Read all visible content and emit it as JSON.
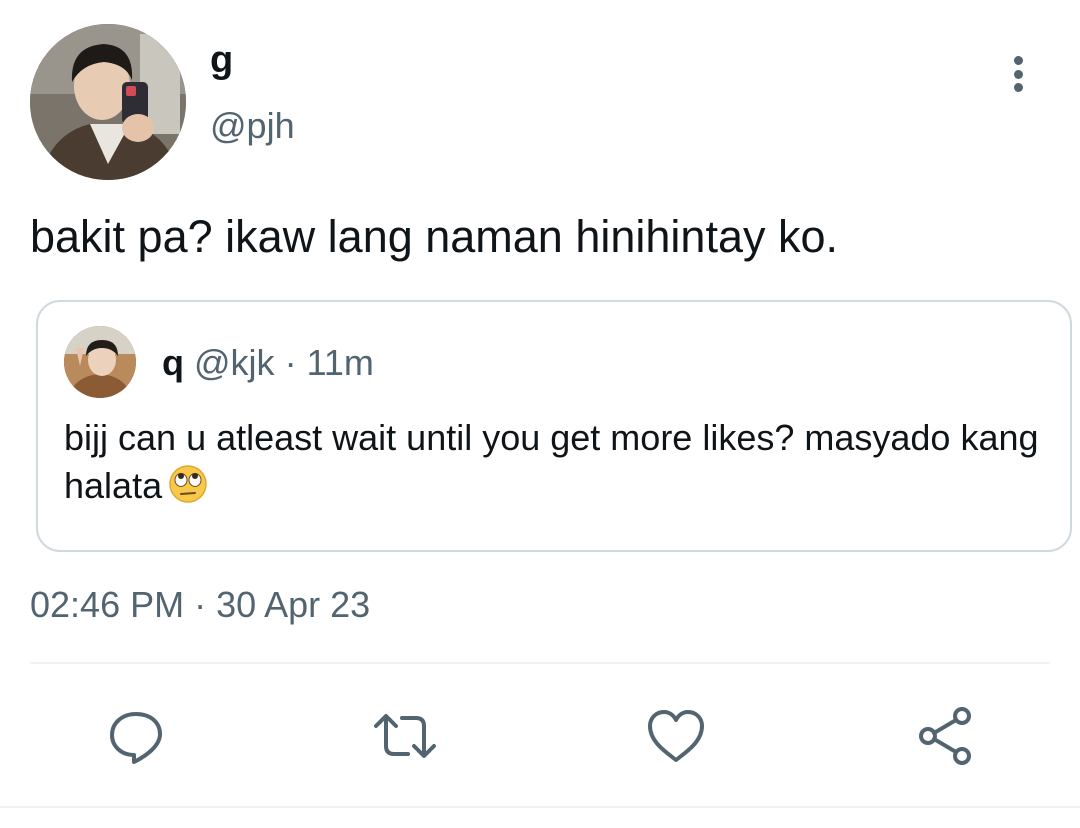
{
  "author": {
    "display_name": "g",
    "handle": "@pjh",
    "avatar_icon": "profile-photo"
  },
  "tweet": {
    "text": "bakit pa? ikaw lang naman hinihintay ko.",
    "timestamp": "02:46 PM · 30 Apr 23"
  },
  "quoted_tweet": {
    "display_name": "q",
    "handle": "@kjk",
    "separator": " · ",
    "time_ago": "11m",
    "text": "bijj can u atleast wait until you get more likes? masyado kang halata",
    "emoji": "face-with-rolling-eyes"
  },
  "actions": [
    {
      "icon": "reply-icon"
    },
    {
      "icon": "retweet-icon"
    },
    {
      "icon": "like-icon"
    },
    {
      "icon": "share-icon"
    }
  ],
  "colors": {
    "primary_text": "#0f1419",
    "secondary_text": "#536471",
    "border": "#cfd9de",
    "divider": "#eff3f4"
  }
}
